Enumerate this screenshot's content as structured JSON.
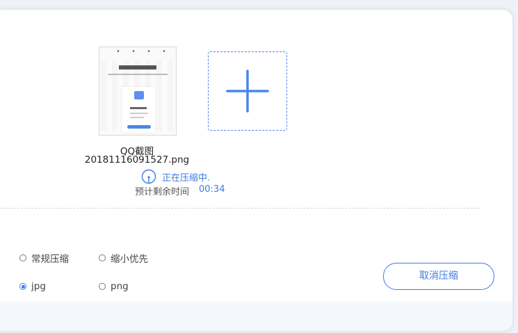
{
  "file": {
    "name_line1": "QQ截图",
    "name_line2": "20181116091527.png"
  },
  "status": {
    "progress_text": "正在压缩中.",
    "remaining_label": "预计剩余时间",
    "remaining_time": "00:34"
  },
  "add_tile": {
    "icon": "plus-icon"
  },
  "options": {
    "mode": [
      {
        "label": "常规压缩",
        "checked": false
      },
      {
        "label": "缩小优先",
        "checked": false
      }
    ],
    "format": [
      {
        "label": "jpg",
        "checked": true
      },
      {
        "label": "png",
        "checked": false
      }
    ]
  },
  "actions": {
    "cancel_label": "取消压缩"
  },
  "colors": {
    "accent": "#3d7be3",
    "background": "#eef1f6"
  }
}
